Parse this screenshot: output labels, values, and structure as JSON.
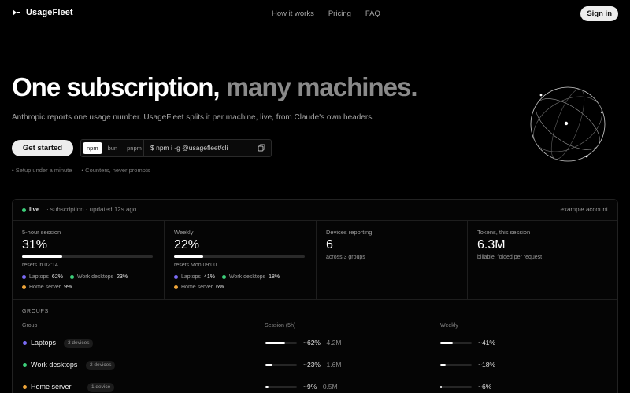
{
  "header": {
    "brand": "UsageFleet",
    "nav": [
      "How it works",
      "Pricing",
      "FAQ"
    ],
    "signin": "Sign in"
  },
  "hero": {
    "title_main": "One subscription, ",
    "title_dim": "many machines.",
    "subtitle": "Anthropic reports one usage number. UsageFleet splits it per machine, live, from Claude's own headers.",
    "cta": "Get started",
    "package_managers": [
      "npm",
      "bun",
      "pnpm"
    ],
    "active_pm": "npm",
    "command": "$  npm i -g @usagefleet/cli",
    "notes": [
      "Setup under a minute",
      "Counters, never prompts"
    ]
  },
  "dashboard": {
    "status": "live",
    "status_meta": "· subscription · updated 12s ago",
    "example_label": "example account",
    "stats": [
      {
        "label": "5-hour session",
        "value": "31%",
        "progress": 0.31,
        "meta": "resets in 02:14",
        "split": [
          {
            "name": "Laptops",
            "pct": "62%",
            "color": "#7b6cf6"
          },
          {
            "name": "Work desktops",
            "pct": "23%",
            "color": "#3ccf7a"
          },
          {
            "name": "Home server",
            "pct": "9%",
            "color": "#f0a63a"
          }
        ]
      },
      {
        "label": "Weekly",
        "value": "22%",
        "progress": 0.22,
        "meta": "resets Mon 09:00",
        "split": [
          {
            "name": "Laptops",
            "pct": "41%",
            "color": "#7b6cf6"
          },
          {
            "name": "Work desktops",
            "pct": "18%",
            "color": "#3ccf7a"
          },
          {
            "name": "Home server",
            "pct": "6%",
            "color": "#f0a63a"
          }
        ]
      },
      {
        "label": "Devices reporting",
        "value": "6",
        "meta": "across 3 groups"
      },
      {
        "label": "Tokens, this session",
        "value": "6.3M",
        "meta": "billable, folded per request"
      }
    ],
    "groups_title": "GROUPS",
    "columns": [
      "Group",
      "Session (5h)",
      "Weekly"
    ],
    "groups": [
      {
        "name": "Laptops",
        "badge": "3 devices",
        "color": "#7b6cf6",
        "session": "~62%",
        "session_tokens": "· 4.2M",
        "session_fill": 0.62,
        "weekly": "~41%",
        "weekly_fill": 0.41
      },
      {
        "name": "Work desktops",
        "badge": "2 devices",
        "color": "#3ccf7a",
        "session": "~23%",
        "session_tokens": "· 1.6M",
        "session_fill": 0.23,
        "weekly": "~18%",
        "weekly_fill": 0.18
      },
      {
        "name": "Home server",
        "badge": "1 device",
        "color": "#f0a63a",
        "session": "~9%",
        "session_tokens": "· 0.5M",
        "session_fill": 0.09,
        "weekly": "~6%",
        "weekly_fill": 0.06
      }
    ]
  }
}
